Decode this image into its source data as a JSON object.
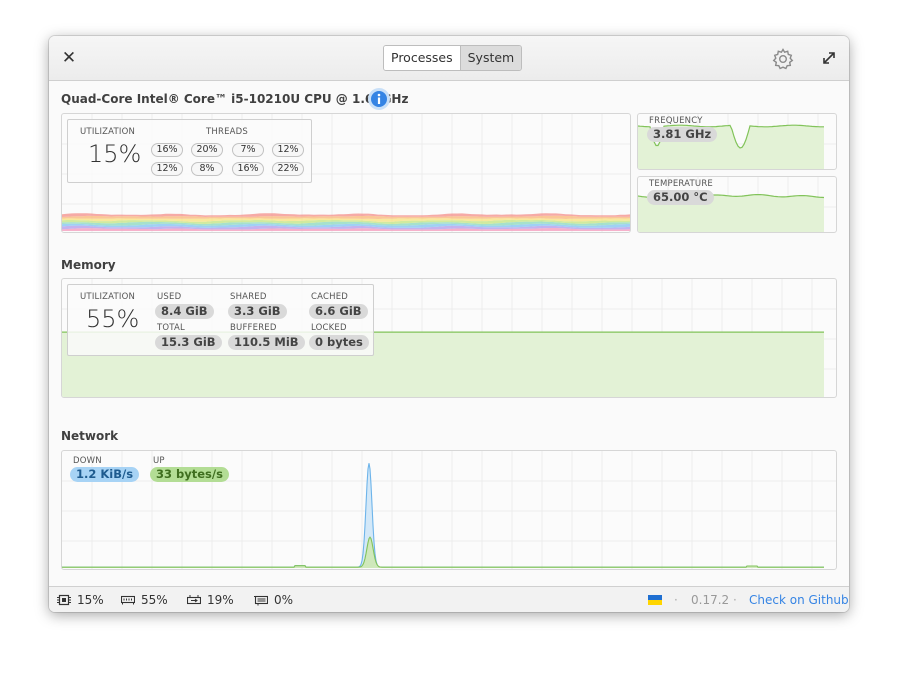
{
  "header": {
    "close_icon": "close-icon",
    "tabs": [
      {
        "label": "Processes",
        "active": true
      },
      {
        "label": "System",
        "active": false
      }
    ],
    "settings_icon": "gear-icon",
    "maximize_icon": "expand-icon"
  },
  "cpu": {
    "title": "Quad-Core Intel® Core™ i5-10210U CPU @ 1.60GHz",
    "info_icon": "info-icon",
    "utilization_label": "UTILIZATION",
    "utilization_value": "15%",
    "threads_label": "THREADS",
    "threads": [
      "16%",
      "20%",
      "7%",
      "12%",
      "12%",
      "8%",
      "16%",
      "22%"
    ],
    "frequency_label": "FREQUENCY",
    "frequency_value": "3.81 GHz",
    "temperature_label": "TEMPERATURE",
    "temperature_value": "65.00 °C"
  },
  "memory": {
    "title": "Memory",
    "utilization_label": "UTILIZATION",
    "utilization_value": "55%",
    "used_label": "USED",
    "used_value": "8.4 GiB",
    "shared_label": "SHARED",
    "shared_value": "3.3 GiB",
    "cached_label": "CACHED",
    "cached_value": "6.6 GiB",
    "total_label": "TOTAL",
    "total_value": "15.3 GiB",
    "buffered_label": "BUFFERED",
    "buffered_value": "110.5 MiB",
    "locked_label": "LOCKED",
    "locked_value": "0 bytes",
    "usage_fraction": 0.55
  },
  "network": {
    "title": "Network",
    "down_label": "DOWN",
    "down_value": "1.2 KiB/s",
    "up_label": "UP",
    "up_value": "33 bytes/s"
  },
  "statusbar": {
    "cpu": {
      "icon": "cpu-icon",
      "value": "15%"
    },
    "memory": {
      "icon": "memory-icon",
      "value": "55%"
    },
    "swap": {
      "icon": "swap-icon",
      "value": "19%"
    },
    "gpu": {
      "icon": "gpu-icon",
      "value": "0%"
    },
    "flag_icon": "ukraine-flag-icon",
    "separator": "·",
    "version": "0.17.2",
    "github_link": "Check on Github"
  },
  "colors": {
    "accent": "#3584e4",
    "graph_green_fill": "#e3f2d6",
    "graph_green_line": "#82c35a",
    "net_down": "#9ccdf3",
    "net_up": "#a9d78a"
  }
}
